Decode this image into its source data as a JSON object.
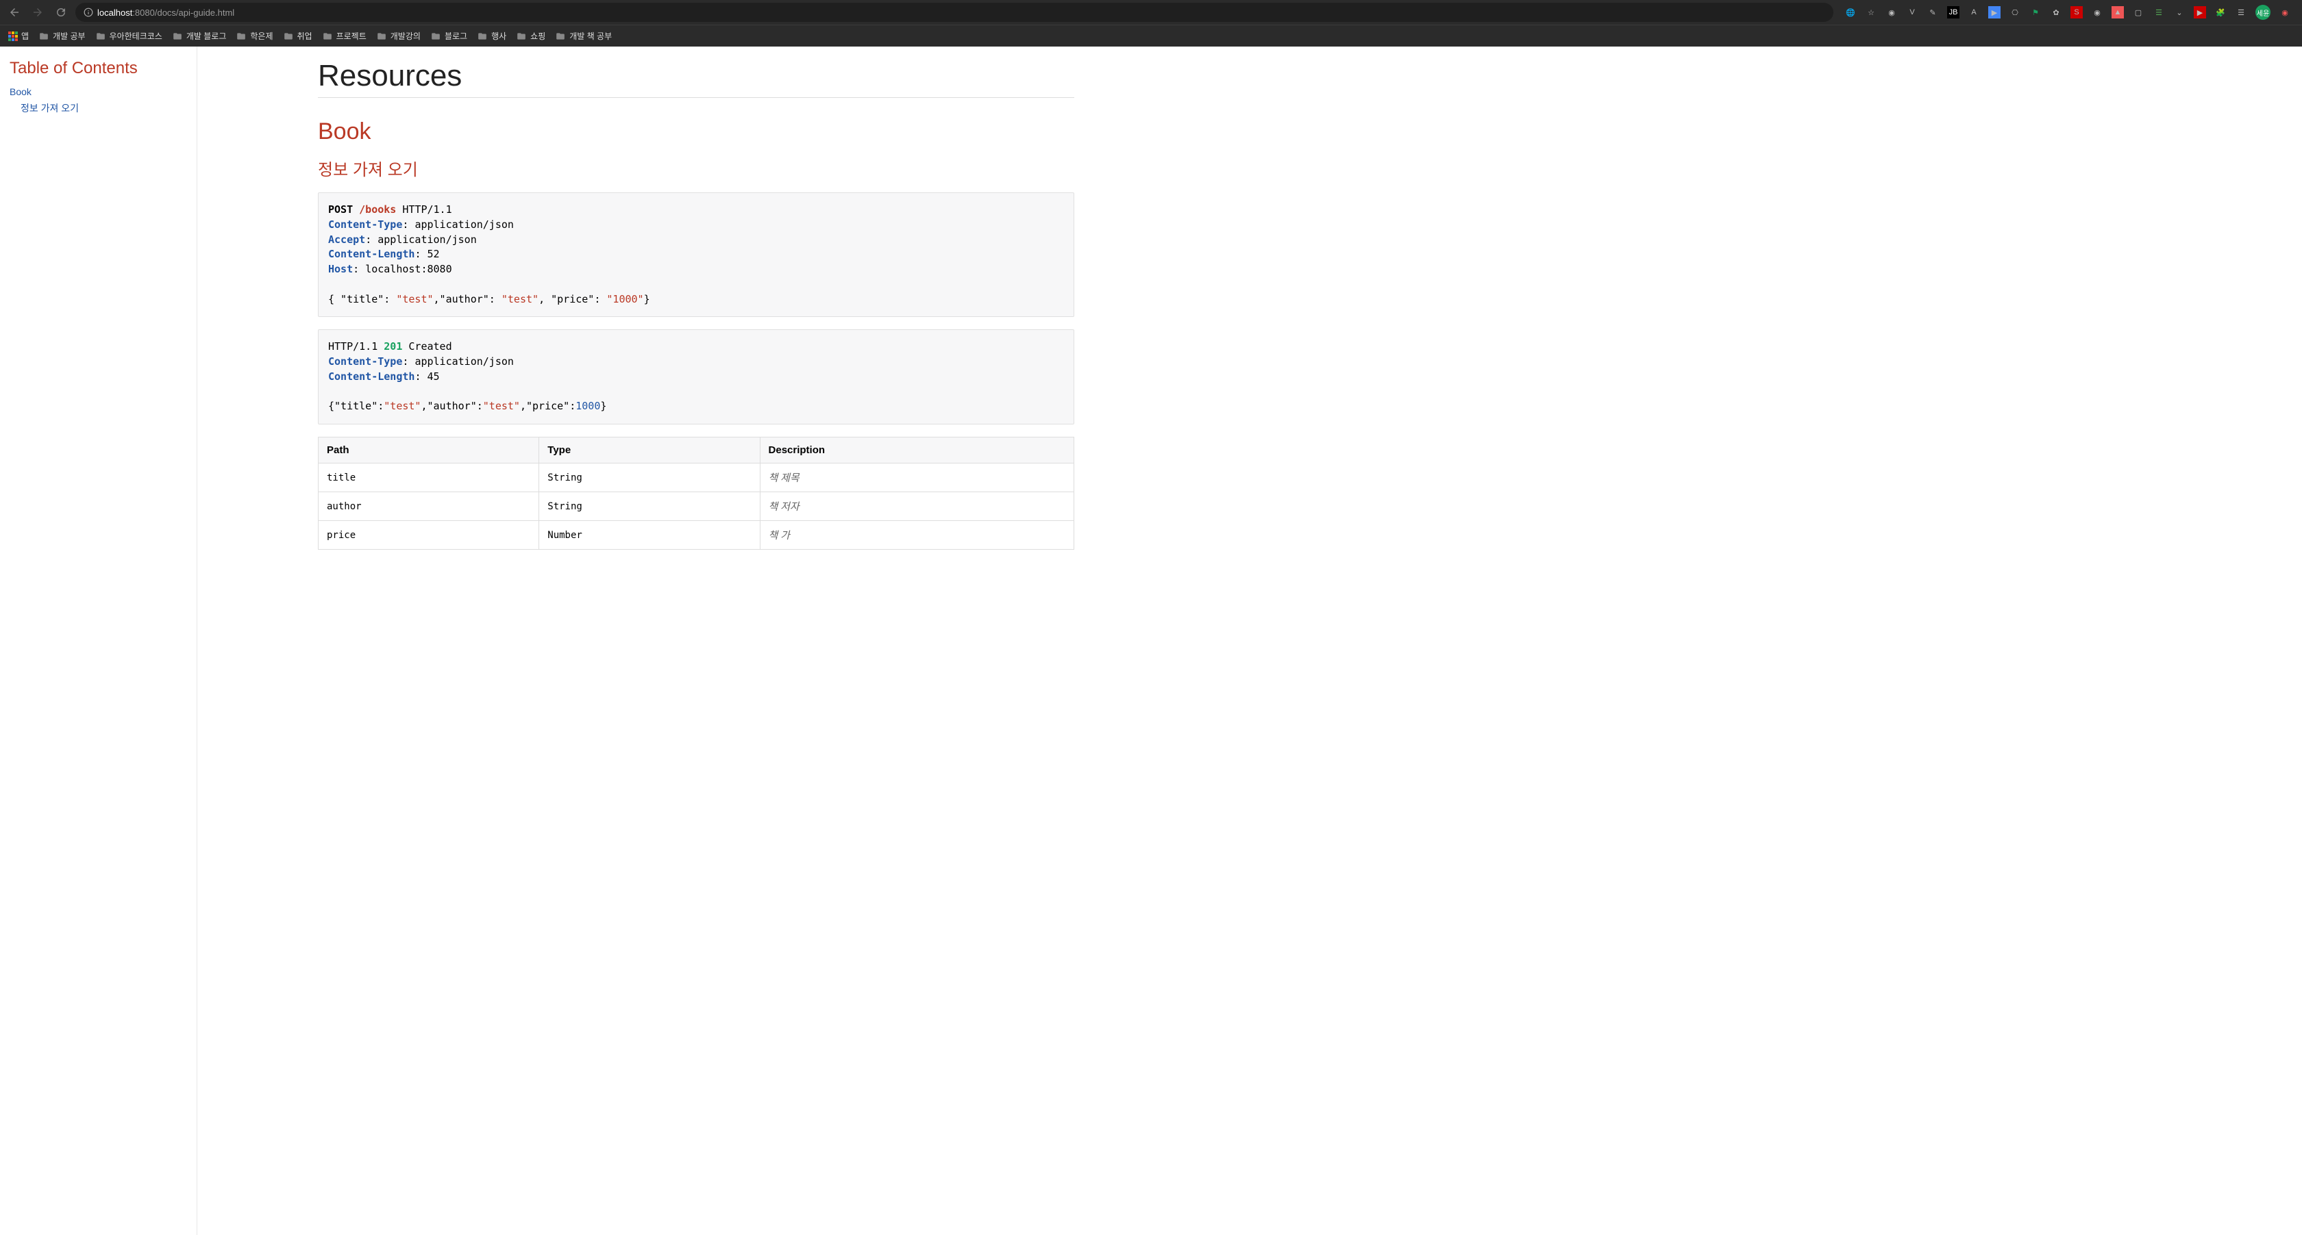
{
  "browser": {
    "url_host": "localhost",
    "url_port": ":8080",
    "url_path": "/docs/api-guide.html",
    "bookmarks": [
      "앱",
      "개발 공부",
      "우아한테크코스",
      "개발 블로그",
      "학은제",
      "취업",
      "프로젝트",
      "개발강의",
      "블로그",
      "행사",
      "쇼핑",
      "개발 책 공부"
    ],
    "avatar": "세윤"
  },
  "toc": {
    "title": "Table of Contents",
    "items": [
      {
        "label": "Book",
        "children": [
          {
            "label": "정보 가져 오기"
          }
        ]
      }
    ]
  },
  "page": {
    "h1": "Resources",
    "sect2": "Book",
    "sect3": "정보 가져 오기",
    "request": {
      "method": "POST",
      "path": "/books",
      "protocol": "HTTP/1.1",
      "headers": [
        {
          "name": "Content-Type",
          "value": "application/json"
        },
        {
          "name": "Accept",
          "value": "application/json"
        },
        {
          "name": "Content-Length",
          "value": "52"
        },
        {
          "name": "Host",
          "value": "localhost:8080"
        }
      ],
      "body_pre": "{ \"title\": ",
      "body_s1": "\"test\"",
      "body_mid1": ",\"author\": ",
      "body_s2": "\"test\"",
      "body_mid2": ", \"price\": ",
      "body_s3": "\"1000\"",
      "body_post": "}"
    },
    "response": {
      "protocol": "HTTP/1.1",
      "status": "201",
      "status_text": "Created",
      "headers": [
        {
          "name": "Content-Type",
          "value": "application/json"
        },
        {
          "name": "Content-Length",
          "value": "45"
        }
      ],
      "body_pre": "{\"title\":",
      "body_s1": "\"test\"",
      "body_mid1": ",\"author\":",
      "body_s2": "\"test\"",
      "body_mid2": ",\"price\":",
      "body_n1": "1000",
      "body_post": "}"
    },
    "table": {
      "headers": [
        "Path",
        "Type",
        "Description"
      ],
      "rows": [
        {
          "path": "title",
          "type": "String",
          "desc": "책 제목"
        },
        {
          "path": "author",
          "type": "String",
          "desc": "책 저자"
        },
        {
          "path": "price",
          "type": "Number",
          "desc": "책 가"
        }
      ]
    }
  }
}
